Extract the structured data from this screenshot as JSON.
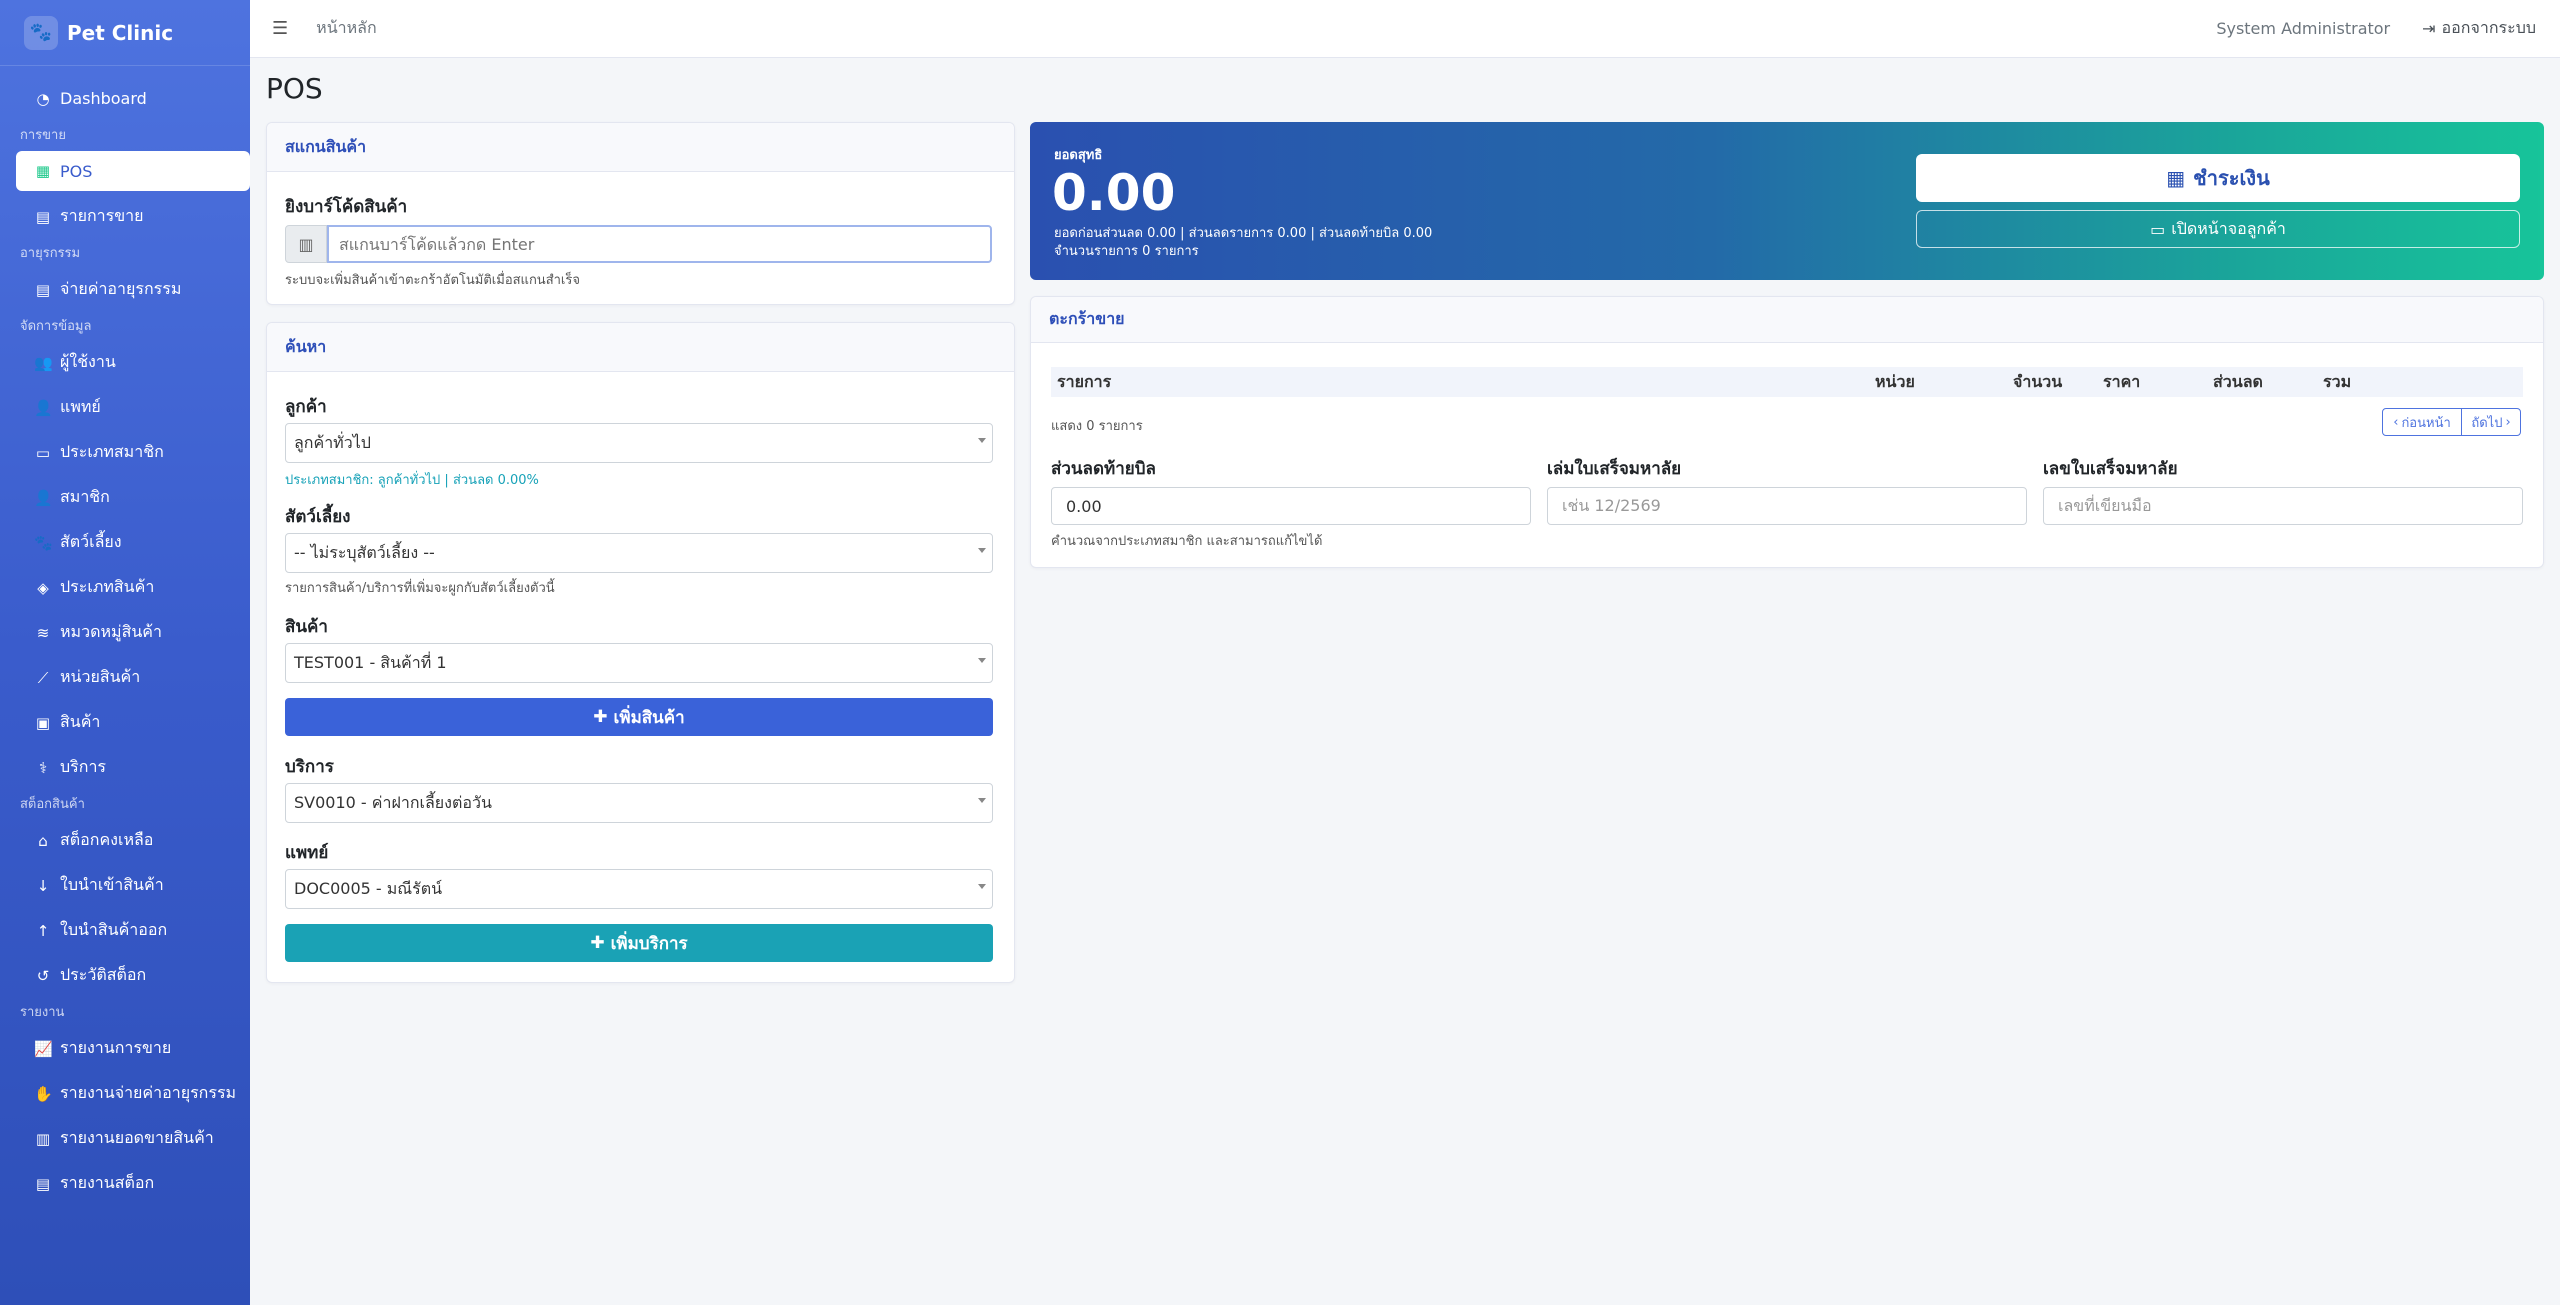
{
  "brand": {
    "name": "Pet Clinic",
    "icon": "paw-icon"
  },
  "sidebar": {
    "dashboard": "Dashboard",
    "sections": {
      "sales": "การขาย",
      "commission": "อายุรกรรม",
      "manage": "จัดการข้อมูล",
      "stock": "สต็อกสินค้า",
      "report": "รายงาน"
    },
    "items": {
      "pos": "POS",
      "sales_list": "รายการขาย",
      "pay_commission": "จ่ายค่าอายุรกรรม",
      "users": "ผู้ใช้งาน",
      "doctors": "แพทย์",
      "member_types": "ประเภทสมาชิก",
      "members": "สมาชิก",
      "pets": "สัตว์เลี้ยง",
      "product_types": "ประเภทสินค้า",
      "product_categories": "หมวดหมู่สินค้า",
      "product_units": "หน่วยสินค้า",
      "products": "สินค้า",
      "services": "บริการ",
      "stock_balance": "สต็อกคงเหลือ",
      "stock_in": "ใบนำเข้าสินค้า",
      "stock_out": "ใบนำสินค้าออก",
      "stock_history": "ประวัติสต็อก",
      "report_sales": "รายงานการขาย",
      "report_commission": "รายงานจ่ายค่าอายุรกรรม",
      "report_product_sales": "รายงานยอดขายสินค้า",
      "report_stock": "รายงานสต็อก"
    }
  },
  "topbar": {
    "breadcrumb": "หน้าหลัก",
    "user": "System Administrator",
    "logout": "ออกจากระบบ"
  },
  "page": {
    "title": "POS"
  },
  "scan_card": {
    "header": "สแกนสินค้า",
    "label": "ยิงบาร์โค้ดสินค้า",
    "placeholder": "สแกนบาร์โค้ดแล้วกด Enter",
    "help": "ระบบจะเพิ่มสินค้าเข้าตะกร้าอัตโนมัติเมื่อสแกนสำเร็จ"
  },
  "search_card": {
    "header": "ค้นหา",
    "customer_label": "ลูกค้า",
    "customer_value": "ลูกค้าทั่วไป",
    "customer_help": "ประเภทสมาชิก: ลูกค้าทั่วไป | ส่วนลด 0.00%",
    "pet_label": "สัตว์เลี้ยง",
    "pet_value": "-- ไม่ระบุสัตว์เลี้ยง --",
    "pet_help": "รายการสินค้า/บริการที่เพิ่มจะผูกกับสัตว์เลี้ยงตัวนี้",
    "product_label": "สินค้า",
    "product_value": "TEST001 - สินค้าที่ 1",
    "add_product": "เพิ่มสินค้า",
    "service_label": "บริการ",
    "service_value": "SV0010 - ค่าฝากเลี้ยงต่อวัน",
    "doctor_label": "แพทย์",
    "doctor_value": "DOC0005 - มณีรัตน์",
    "add_service": "เพิ่มบริการ"
  },
  "summary": {
    "label": "ยอดสุทธิ",
    "total": "0.00",
    "line1": "ยอดก่อนส่วนลด 0.00 | ส่วนลดรายการ 0.00 | ส่วนลดท้ายบิล 0.00",
    "line2": "จำนวนรายการ 0 รายการ",
    "pay": "ชำระเงิน",
    "customer_display": "เปิดหน้าจอลูกค้า"
  },
  "cart": {
    "header": "ตะกร้าขาย",
    "columns": [
      "รายการ",
      "หน่วย",
      "จำนวน",
      "ราคา",
      "ส่วนลด",
      "รวม"
    ],
    "showing": "แสดง 0 รายการ",
    "prev": "ก่อนหน้า",
    "next": "ถัดไป",
    "bill_discount_label": "ส่วนลดท้ายบิล",
    "bill_discount_value": "0.00",
    "bill_discount_help": "คำนวณจากประเภทสมาชิก และสามารถแก้ไขได้",
    "receipt_book_label": "เล่มใบเสร็จมหาลัย",
    "receipt_book_placeholder": "เช่น 12/2569",
    "receipt_no_label": "เลขใบเสร็จมหาลัย",
    "receipt_no_placeholder": "เลขที่เขียนมือ"
  },
  "colors": {
    "primary": "#4e73df",
    "teal": "#1aa2b5",
    "success": "#1cc88a"
  }
}
